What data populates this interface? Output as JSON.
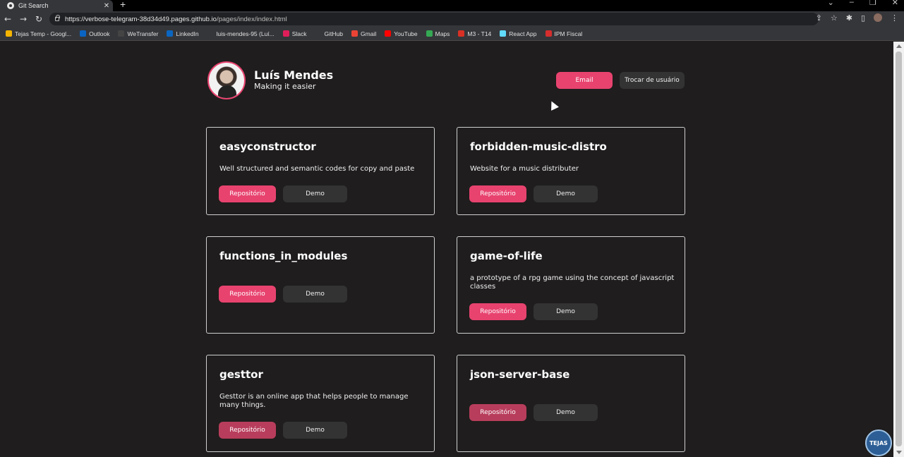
{
  "browser": {
    "tab_title": "Git Search",
    "tab_close": "✕",
    "new_tab": "+",
    "url_host": "https://verbose-telegram-38d34d49.pages.github.io",
    "url_path": "/pages/index/index.html",
    "bookmarks": [
      {
        "label": "Tejas Temp - Googl...",
        "color": "#f4b400"
      },
      {
        "label": "Outlook",
        "color": "#0a64c2"
      },
      {
        "label": "WeTransfer",
        "color": "#444444"
      },
      {
        "label": "LinkedIn",
        "color": "#0a66c2"
      },
      {
        "label": "luis-mendes-95 (Luí...",
        "color": "#35363a"
      },
      {
        "label": "Slack",
        "color": "#e01e5a"
      },
      {
        "label": "GitHub",
        "color": "#35363a"
      },
      {
        "label": "Gmail",
        "color": "#ea4335"
      },
      {
        "label": "YouTube",
        "color": "#ff0000"
      },
      {
        "label": "Maps",
        "color": "#34a853"
      },
      {
        "label": "M3 - T14",
        "color": "#d93025"
      },
      {
        "label": "React App",
        "color": "#61dafb"
      },
      {
        "label": "IPM Fiscal",
        "color": "#d62d2d"
      }
    ]
  },
  "profile": {
    "name": "Luís Mendes",
    "tagline": "Making it easier"
  },
  "header_buttons": {
    "email": "Email",
    "switch_user": "Trocar de usuário"
  },
  "cards": [
    {
      "title": "easyconstructor",
      "description": "Well structured and semantic codes for copy and paste",
      "repo": "Repositório",
      "demo": "Demo"
    },
    {
      "title": "forbidden-music-distro",
      "description": "Website for a music distributer",
      "repo": "Repositório",
      "demo": "Demo"
    },
    {
      "title": "functions_in_modules",
      "description": "",
      "repo": "Repositório",
      "demo": "Demo"
    },
    {
      "title": "game-of-life",
      "description": "a prototype of a rpg game using the concept of javascript classes",
      "repo": "Repositório",
      "demo": "Demo"
    },
    {
      "title": "gesttor",
      "description": "Gesttor is an online app that helps people to manage many things.",
      "repo": "Repositório",
      "demo": "Demo"
    },
    {
      "title": "json-server-base",
      "description": "",
      "repo": "Repositório",
      "demo": "Demo"
    }
  ],
  "watermark": "TEJAS",
  "colors": {
    "accent": "#e8436f",
    "background": "#1f1d1d",
    "secondary_button": "#333333"
  }
}
